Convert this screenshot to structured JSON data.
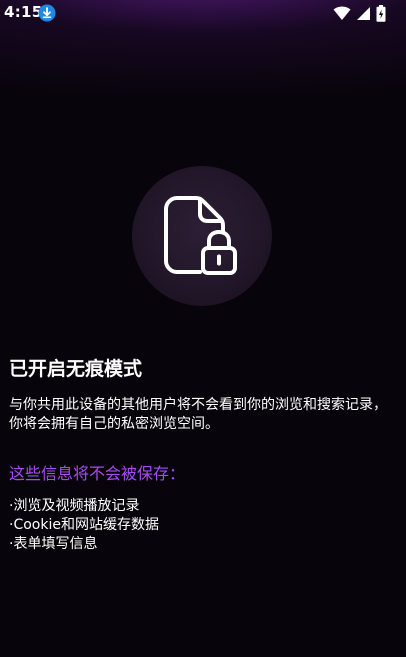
{
  "status_bar": {
    "time": "4:15",
    "icons": [
      "download-icon",
      "wifi-icon",
      "signal-icon",
      "battery-icon"
    ]
  },
  "incognito": {
    "icon": "document-lock-icon",
    "title": "已开启无痕模式",
    "description": "与你共用此设备的其他用户将不会看到你的浏览和搜索记录，你将会拥有自己的私密浏览空间。",
    "not_saved_heading": "这些信息将不会被保存：",
    "not_saved_items": [
      "·浏览及视频播放记录",
      "·Cookie和网站缓存数据",
      "·表单填写信息"
    ]
  },
  "colors": {
    "background": "#08040b",
    "accent": "#a64bf4",
    "download_badge": "#1e88e5"
  }
}
